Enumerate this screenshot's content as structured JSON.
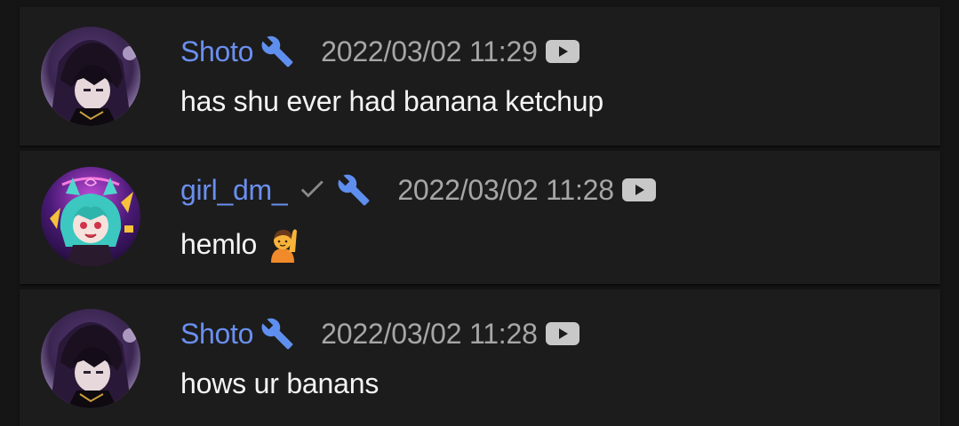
{
  "messages": [
    {
      "author": "Shoto",
      "author_badges": [
        "wrench-icon"
      ],
      "timestamp": "2022/03/02 11:29",
      "text": "has shu ever had banana ketchup",
      "platform_icon": "youtube-icon"
    },
    {
      "author": "girl_dm_",
      "author_badges": [
        "verified-check-icon",
        "wrench-icon"
      ],
      "timestamp": "2022/03/02 11:28",
      "text": "hemlo",
      "text_emoji": "raising-hand-emoji",
      "platform_icon": "youtube-icon"
    },
    {
      "author": "Shoto",
      "author_badges": [
        "wrench-icon"
      ],
      "timestamp": "2022/03/02 11:28",
      "text": "hows ur banans",
      "platform_icon": "youtube-icon"
    }
  ],
  "colors": {
    "background": "#151515",
    "card": "#1c1c1c",
    "author_name": "#6a8ff0",
    "timestamp": "#a6a6a6",
    "message_text": "#f4f4f4",
    "check_badge": "#8a8a8a",
    "wrench_badge": "#5f8fee"
  }
}
